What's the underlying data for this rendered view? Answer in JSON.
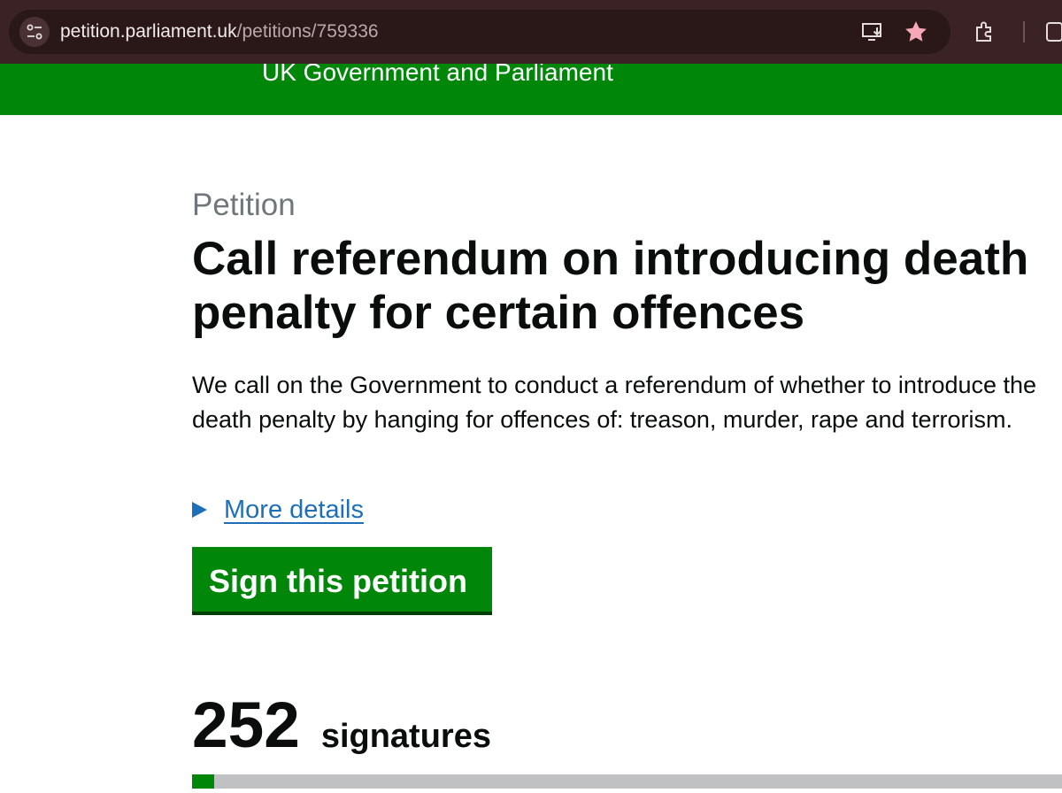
{
  "browser": {
    "url_host": "petition.parliament.uk",
    "url_path": "/petitions/759336",
    "icons": [
      "site-info-icon",
      "install-app-icon",
      "bookmark-star-icon",
      "extensions-icon",
      "tab-icon"
    ],
    "star_color": "#f7a8b8"
  },
  "header": {
    "title": "UK Government and Parliament",
    "background": "#00870a"
  },
  "petition": {
    "caption": "Petition",
    "title": "Call referendum on introducing death penalty for certain offences",
    "action": "We call on the Government to conduct a referendum of whether to introduce the death penalty by hanging for offences of: treason, murder, rape and terrorism.",
    "details_label": "More details",
    "sign_label": "Sign this petition",
    "signature_count": "252",
    "signature_label": "signatures",
    "progress_fraction": 0.025
  },
  "colors": {
    "accent": "#00870a",
    "link": "#1d70b8",
    "text": "#0b0c0c",
    "caption": "#6f777b"
  }
}
